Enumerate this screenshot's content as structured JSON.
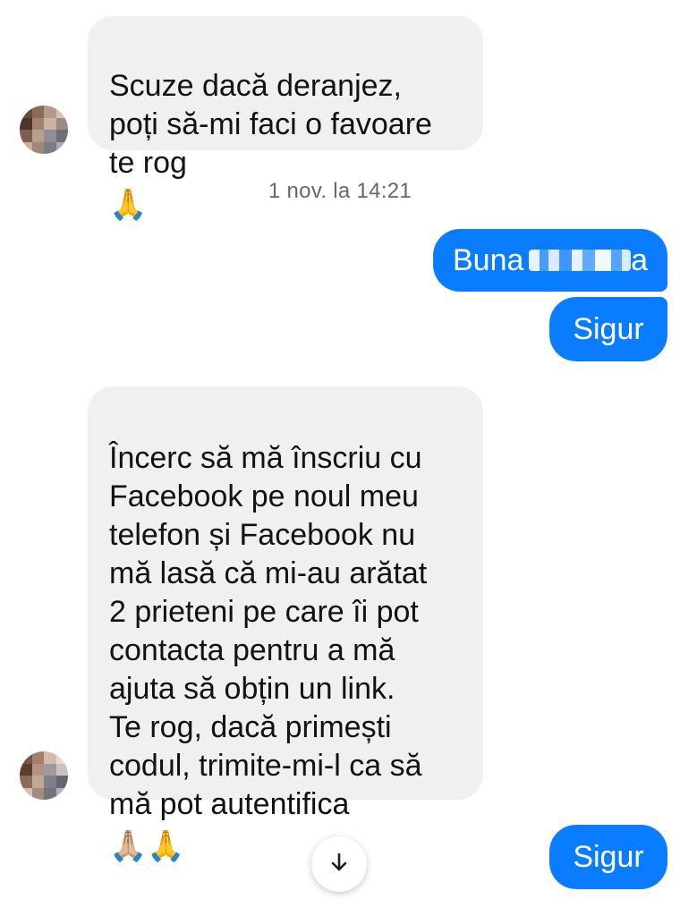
{
  "messages": [
    {
      "direction": "incoming",
      "text": "Scuze dacă deranjez,\npoți să-mi faci o favoare\nte rog",
      "emoji": "🙏"
    },
    {
      "type": "timestamp",
      "text": "1 nov. la 14:21"
    },
    {
      "direction": "outgoing",
      "text": "Buna",
      "redacted_suffix": "a"
    },
    {
      "direction": "outgoing",
      "text": "Sigur"
    },
    {
      "direction": "incoming",
      "text": "Încerc să mă înscriu cu\nFacebook pe noul meu\ntelefon și Facebook nu\nmă lasă că mi-au arătat\n2 prieteni pe care îi pot\ncontacta pentru a mă\najuta să obțin un link.\nTe rog, dacă primești\ncodul, trimite-mi-l ca să\nmă pot autentifica",
      "emoji": "🙏🏼🙏"
    },
    {
      "direction": "outgoing",
      "text": "Sigur"
    }
  ],
  "controls": {
    "scroll_down_icon": "arrow-down-icon",
    "scroll_down_glyph": "↓"
  },
  "colors": {
    "outgoing_bubble": "#0a7cff",
    "incoming_bubble": "#f0f0f2",
    "timestamp_text": "#65676b"
  }
}
